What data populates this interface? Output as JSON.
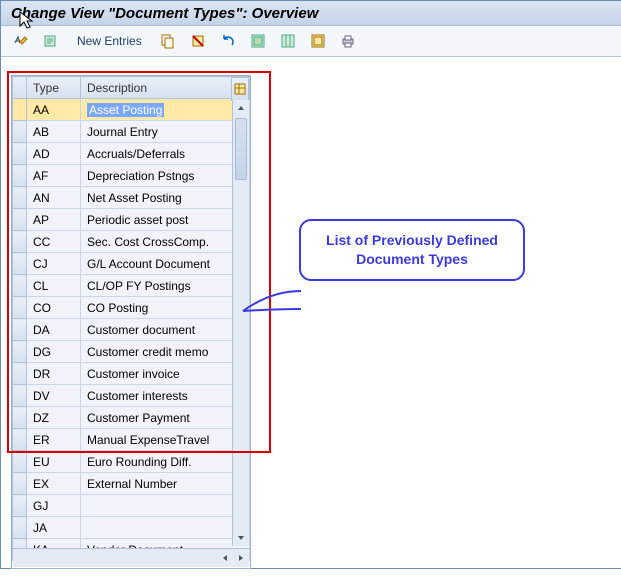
{
  "title": "Change View \"Document Types\": Overview",
  "toolbar": {
    "new_entries": "New Entries"
  },
  "table": {
    "header_type": "Type",
    "header_desc": "Description",
    "rows": [
      {
        "type": "AA",
        "desc": "Asset Posting",
        "selected": true
      },
      {
        "type": "AB",
        "desc": "Journal Entry"
      },
      {
        "type": "AD",
        "desc": "Accruals/Deferrals"
      },
      {
        "type": "AF",
        "desc": "Depreciation Pstngs"
      },
      {
        "type": "AN",
        "desc": "Net Asset Posting"
      },
      {
        "type": "AP",
        "desc": "Periodic asset post"
      },
      {
        "type": "CC",
        "desc": "Sec. Cost CrossComp."
      },
      {
        "type": "CJ",
        "desc": "G/L Account Document"
      },
      {
        "type": "CL",
        "desc": "CL/OP FY Postings"
      },
      {
        "type": "CO",
        "desc": "CO Posting"
      },
      {
        "type": "DA",
        "desc": "Customer document"
      },
      {
        "type": "DG",
        "desc": "Customer credit memo"
      },
      {
        "type": "DR",
        "desc": "Customer invoice"
      },
      {
        "type": "DV",
        "desc": "Customer interests"
      },
      {
        "type": "DZ",
        "desc": "Customer Payment"
      },
      {
        "type": "ER",
        "desc": "Manual ExpenseTravel"
      },
      {
        "type": "EU",
        "desc": "Euro Rounding Diff."
      },
      {
        "type": "EX",
        "desc": "External Number"
      },
      {
        "type": "GJ",
        "desc": ""
      },
      {
        "type": "JA",
        "desc": ""
      },
      {
        "type": "KA",
        "desc": "Vendor Document"
      }
    ]
  },
  "callout": {
    "line1": "List of Previously Defined",
    "line2": "Document Types"
  }
}
